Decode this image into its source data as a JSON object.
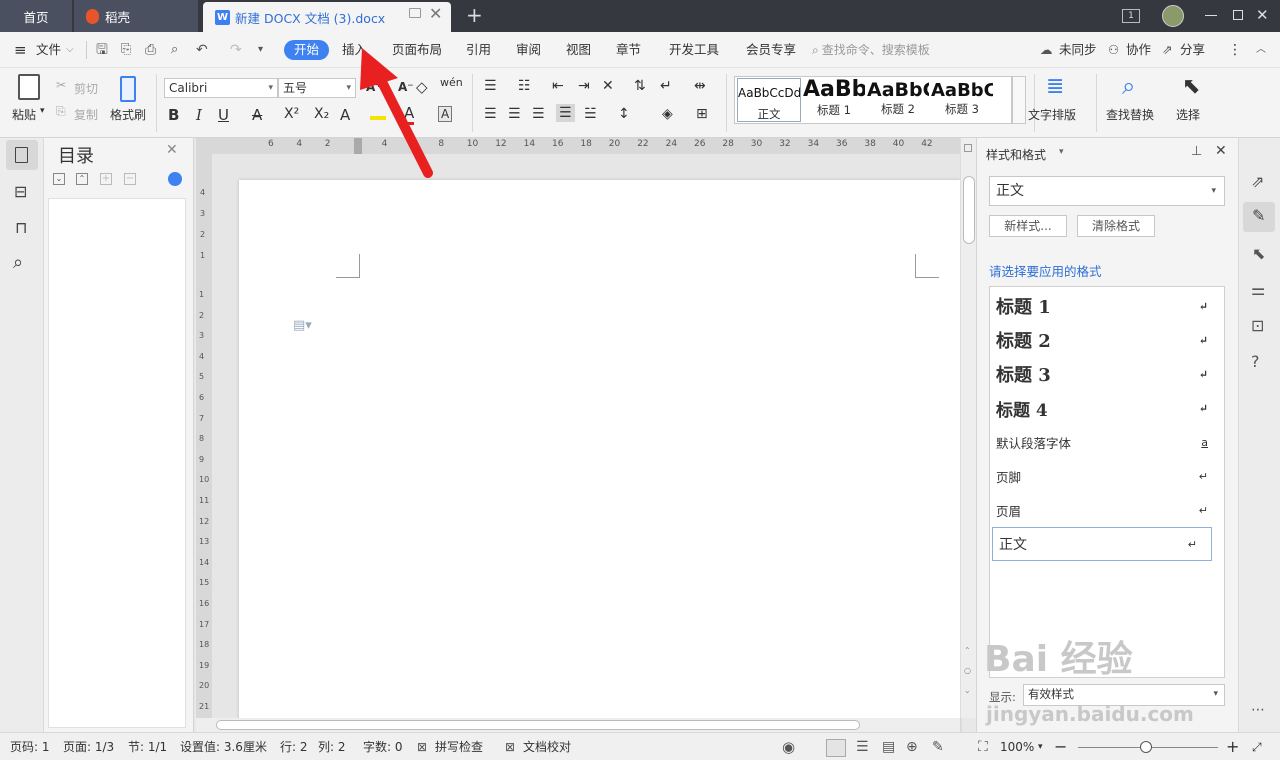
{
  "tabs": {
    "home": "首页",
    "daoke": "稻壳",
    "doc": "新建 DOCX 文档 (3).docx",
    "doc_badge": "W"
  },
  "window": {
    "page_badge": "1"
  },
  "menubar": {
    "file": "文件",
    "items": [
      "开始",
      "插入",
      "页面布局",
      "引用",
      "审阅",
      "视图",
      "章节",
      "开发工具",
      "会员专享"
    ],
    "search_placeholder": "查找命令、搜索模板",
    "sync": "未同步",
    "collab": "协作",
    "share": "分享"
  },
  "ribbon": {
    "paste": "粘贴",
    "cut": "剪切",
    "copy": "复制",
    "format_painter": "格式刷",
    "font_name": "Calibri",
    "font_size": "五号",
    "bold": "B",
    "italic": "I",
    "underline": "U",
    "fontcolor_a": "A",
    "superscript": "X²",
    "subscript": "X₂",
    "text_layout": "文字排版",
    "find_replace": "查找替换",
    "select": "选择",
    "styles": [
      {
        "preview": "AaBbCcDd",
        "label": "正文"
      },
      {
        "preview": "AaBb",
        "label": "标题 1"
      },
      {
        "preview": "AaBbC",
        "label": "标题 2"
      },
      {
        "preview": "AaBbC",
        "label": "标题 3"
      }
    ]
  },
  "nav": {
    "title": "目录"
  },
  "ruler": {
    "h_ticks": [
      "6",
      "4",
      "2",
      "2",
      "4",
      "6",
      "8",
      "10",
      "12",
      "14",
      "16",
      "18",
      "20",
      "22",
      "24",
      "26",
      "28",
      "30",
      "32",
      "34",
      "36",
      "38",
      "40",
      "42"
    ],
    "v_ticks_top": [
      "4",
      "3",
      "2",
      "1"
    ],
    "v_ticks": [
      "1",
      "2",
      "3",
      "4",
      "5",
      "6",
      "7",
      "8",
      "9",
      "10",
      "11",
      "12",
      "13",
      "14",
      "15",
      "16",
      "17",
      "18",
      "19",
      "20",
      "21"
    ]
  },
  "styles_pane": {
    "title": "样式和格式",
    "current": "正文",
    "new_style": "新样式...",
    "clear_format": "清除格式",
    "prompt": "请选择要应用的格式",
    "items": [
      {
        "label": "标题  1",
        "mark": "↵"
      },
      {
        "label": "标题  2",
        "mark": "↵"
      },
      {
        "label": "标题  3",
        "mark": "↵"
      },
      {
        "label": "标题  4",
        "mark": "↵"
      },
      {
        "label": "默认段落字体",
        "mark": "a"
      },
      {
        "label": "页脚",
        "mark": "↵"
      },
      {
        "label": "页眉",
        "mark": "↵"
      },
      {
        "label": "正文",
        "mark": "↵"
      }
    ],
    "show_label": "显示:",
    "show_value": "有效样式"
  },
  "status": {
    "page": "页码: 1",
    "pages": "页面: 1/3",
    "section": "节: 1/1",
    "setting": "设置值: 3.6厘米",
    "row": "行: 2",
    "col": "列: 2",
    "words": "字数: 0",
    "spell": "拼写检查",
    "proof": "文档校对",
    "zoom": "100%"
  },
  "watermark": {
    "line1": "Bai 经验",
    "line2": "jingyan.baidu.com"
  },
  "colors": {
    "accent": "#3d82f0",
    "titlebar": "#35383f",
    "arrow": "#e8201f"
  }
}
